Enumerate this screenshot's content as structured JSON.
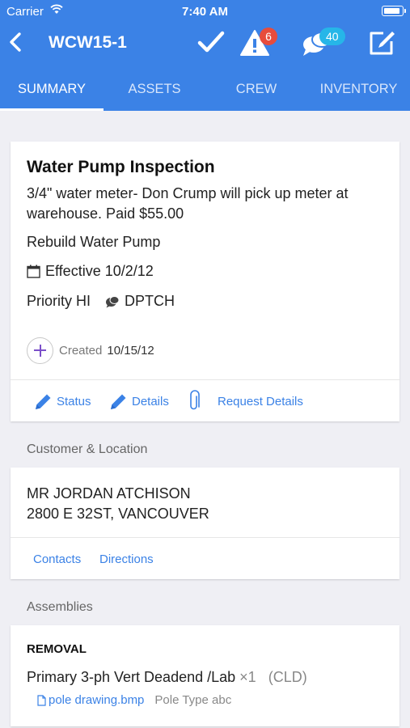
{
  "status_bar": {
    "carrier": "Carrier",
    "time": "7:40 AM"
  },
  "nav": {
    "title": "WCW15-1",
    "alert_count": "6",
    "message_count": "40"
  },
  "tabs": [
    {
      "label": "SUMMARY",
      "active": true
    },
    {
      "label": "ASSETS",
      "active": false
    },
    {
      "label": "CREW",
      "active": false
    },
    {
      "label": "INVENTORY",
      "active": false
    }
  ],
  "work_order": {
    "title": "Water Pump Inspection",
    "description": "3/4\" water meter- Don Crump will pick up meter at warehouse. Paid $55.00",
    "task": "Rebuild Water Pump",
    "effective": "Effective 10/2/12",
    "priority": "Priority HI",
    "dispatch": "DPTCH",
    "created_label": "Created",
    "created_date": "10/15/12",
    "actions": {
      "status": "Status",
      "details": "Details",
      "request_details": "Request Details"
    }
  },
  "customer": {
    "section_label": "Customer & Location",
    "name": "MR JORDAN ATCHISON",
    "address": "2800 E 32ST, VANCOUVER",
    "contacts": "Contacts",
    "directions": "Directions"
  },
  "assemblies": {
    "section_label": "Assemblies",
    "heading": "REMOVAL",
    "item": "Primary 3-ph Vert Deadend /Lab",
    "qty": "×1",
    "code": "(CLD)",
    "file": "pole drawing.bmp",
    "pole_type": "Pole Type abc"
  },
  "colors": {
    "accent": "#3b82e6",
    "badge_red": "#e74c3c",
    "badge_cyan": "#26b6e8",
    "background": "#efeff4"
  }
}
